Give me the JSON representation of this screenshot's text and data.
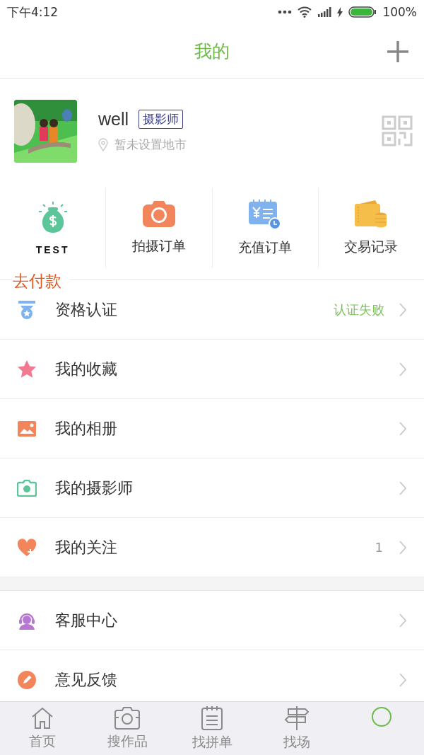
{
  "status_bar": {
    "time": "下午4:12",
    "battery": "100%"
  },
  "header": {
    "title": "我的"
  },
  "profile": {
    "name": "well",
    "badge": "摄影师",
    "location": "暂未设置地市"
  },
  "shortcuts": [
    {
      "label": "TEST"
    },
    {
      "label": "拍摄订单"
    },
    {
      "label": "充值订单"
    },
    {
      "label": "交易记录"
    }
  ],
  "pay_label": "去付款",
  "menu_sections": [
    [
      {
        "label": "资格认证",
        "status": "认证失败"
      },
      {
        "label": "我的收藏"
      },
      {
        "label": "我的相册"
      },
      {
        "label": "我的摄影师"
      },
      {
        "label": "我的关注",
        "count": "1"
      }
    ],
    [
      {
        "label": "客服中心"
      },
      {
        "label": "意见反馈"
      }
    ]
  ],
  "tab_bar": [
    {
      "label": "首页",
      "selected": false
    },
    {
      "label": "搜作品",
      "selected": false
    },
    {
      "label": "找拼单",
      "selected": false
    },
    {
      "label": "找场",
      "selected": false
    },
    {
      "selected": true
    }
  ]
}
